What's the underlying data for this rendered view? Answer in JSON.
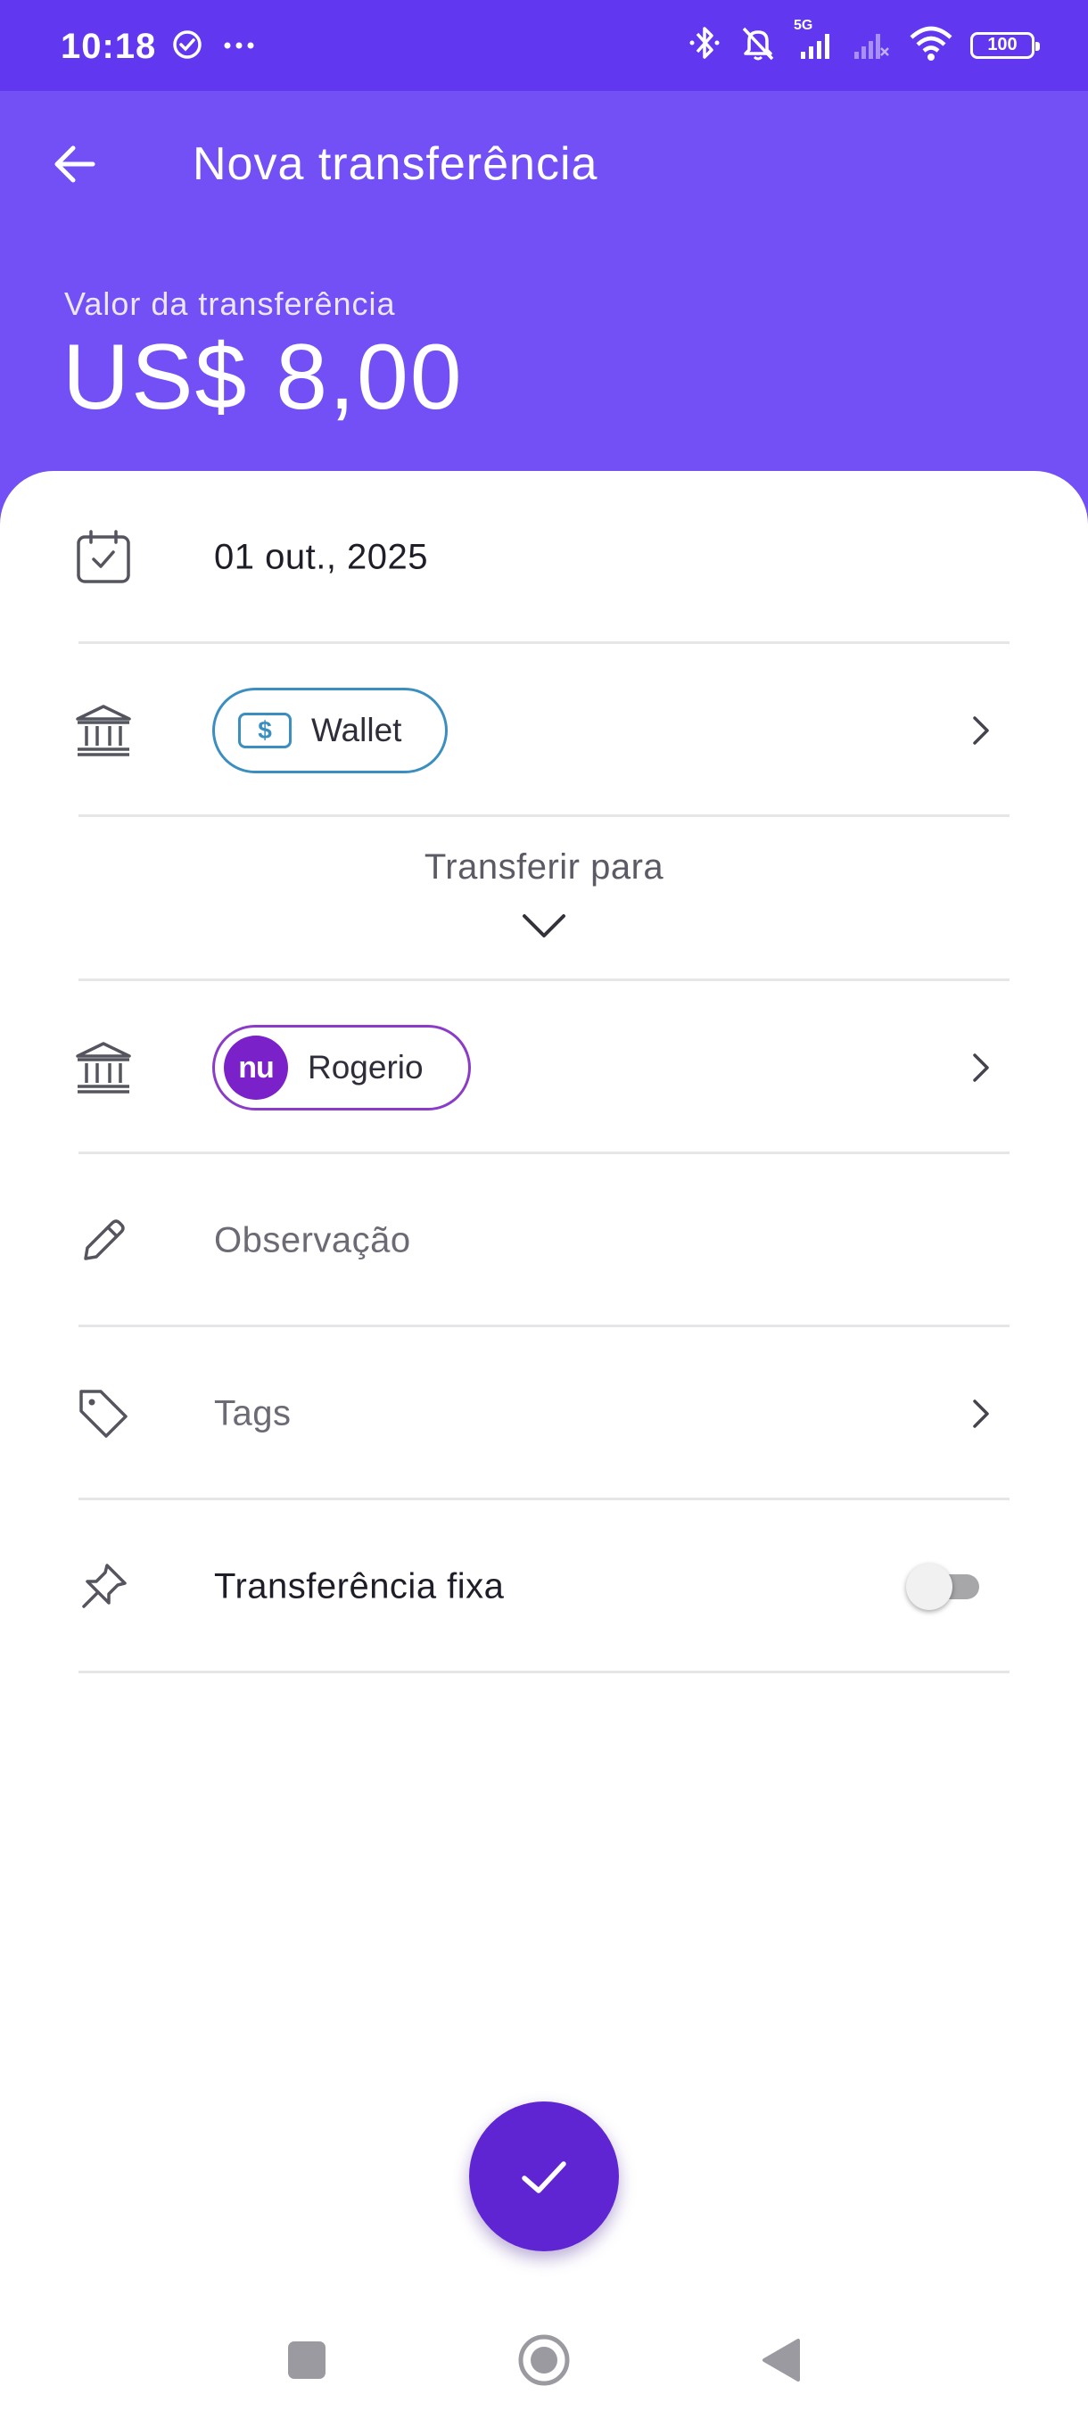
{
  "status_bar": {
    "time": "10:18",
    "battery": "100",
    "network": "5G",
    "icons": [
      "check-circle-icon",
      "more-dots-icon",
      "bluetooth-icon",
      "mute-bell-icon",
      "signal-icon",
      "signal-empty-icon",
      "wifi-icon",
      "battery-icon"
    ]
  },
  "header": {
    "title": "Nova transferência",
    "amount_label": "Valor da transferência",
    "amount_value": "US$ 8,00"
  },
  "form": {
    "date": "01 out., 2025",
    "from_account": {
      "name": "Wallet",
      "icon": "dollar-icon",
      "color": "#3b8ec0"
    },
    "transfer_to_label": "Transferir para",
    "to_account": {
      "name": "Rogerio",
      "avatar_text": "nu",
      "color": "#7a21c9"
    },
    "note_placeholder": "Observação",
    "tags_label": "Tags",
    "fixed_transfer_label": "Transferência fixa",
    "fixed_transfer_enabled": false
  },
  "colors": {
    "status_bar": "#6137ef",
    "header": "#7350f5",
    "fab": "#5f25d2"
  },
  "fab": {
    "icon": "check-icon"
  },
  "nav": {
    "icons": [
      "recents-square-icon",
      "home-circle-icon",
      "back-triangle-icon"
    ]
  }
}
